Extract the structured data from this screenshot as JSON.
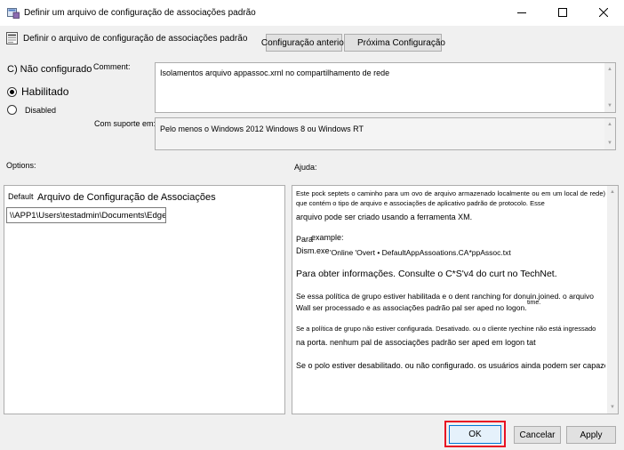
{
  "window": {
    "title": "Definir um arquivo de configuração de associações padrão"
  },
  "header": {
    "policy_name": "Definir o arquivo de configuração de associações padrão",
    "prev_button": "Configuração anterior",
    "next_button": "Próxima Configuração"
  },
  "state": {
    "not_configured": "C) Não configurado",
    "enabled": "Habilitado",
    "disabled": "Disabled",
    "selected": "enabled"
  },
  "comment": {
    "label": "Comment:",
    "value": "Isolamentos arquivo appassoc.xrnl no compartilhamento de rede"
  },
  "supported": {
    "label": "Com suporte em:",
    "value": "Pelo menos o Windows 2012 Windows 8 ou Windows RT"
  },
  "options": {
    "label": "Options:",
    "default_label": "Default",
    "field_label": "Arquivo de Configuração de Associações",
    "field_value": "\\\\APP1\\Users\\testadmin\\Documents\\Edge"
  },
  "help": {
    "label": "Ajuda:",
    "p1": "Este pock septets o caminho para um ovo de arquivo armazenado localmente ou em um local de rede) que contém o tipo de arquivo e associações de aplicativo padrão de protocolo. Esse",
    "p2": "arquivo pode ser criado usando a ferramenta XM.",
    "p3_a": "Para",
    "p3_b": "example:",
    "p4_a": "Dism.exe",
    "p4_b": "'Online 'Overt • DefaultAppAssoations.CA*ppAssoc.txt",
    "p5": "Para obter informações. Consulte o C*S'v4 do curt no TechNet.",
    "p6": "Se essa política de grupo estiver habilitada e o dent ranching for donuin.joined. o arquivo Wall ser processado e as associações padrão pal ser aped no logon.",
    "p6_extra": "time.",
    "p7": "Se a política de grupo não estiver configurada. Desativado. ou o cliente ryechine não está ingressado",
    "p8": "na porta. nenhum pal de associações padrão ser aped em logon tat",
    "p9": "Se o polo estiver desabilitado. ou não configurado. os usuários ainda podem ser capazes de"
  },
  "footer": {
    "ok": "OK",
    "cancel": "Cancelar",
    "apply": "Apply",
    "highlight_color": "#e81123"
  }
}
